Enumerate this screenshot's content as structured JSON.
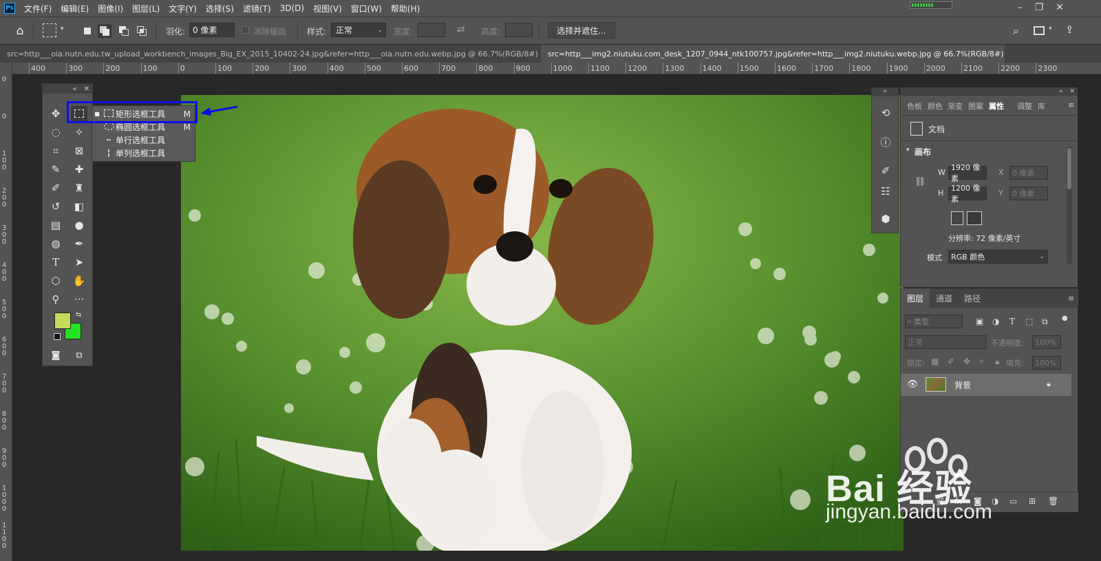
{
  "menu": {
    "logo": "Ps",
    "items": [
      "文件(F)",
      "编辑(E)",
      "图像(I)",
      "图层(L)",
      "文字(Y)",
      "选择(S)",
      "滤镜(T)",
      "3D(D)",
      "视图(V)",
      "窗口(W)",
      "帮助(H)"
    ],
    "progress": 0.55
  },
  "options": {
    "feather_label": "羽化:",
    "feather_value": "0 像素",
    "antialias_label": "消除锯齿",
    "style_label": "样式:",
    "style_value": "正常",
    "width_label": "宽度:",
    "height_label": "高度:",
    "select_mask_label": "选择并遮住..."
  },
  "tabs": [
    {
      "label": "src=http___oia.nutn.edu.tw_upload_workbench_images_Big_EX_2015_10402-24.jpg&refer=http___oia.nutn.edu.webp.jpg @ 66.7%(RGB/8#)",
      "close": "×"
    },
    {
      "label": "src=http___img2.niutuku.com_desk_1207_0944_ntk100757.jpg&refer=http___img2.niutuku.webp.jpg @ 66.7%(RGB/8#)",
      "close": "×"
    }
  ],
  "ruler": {
    "top": [
      "400",
      "300",
      "200",
      "100",
      "0",
      "100",
      "200",
      "300",
      "400",
      "500",
      "600",
      "700",
      "800",
      "900",
      "1000",
      "1100",
      "1200",
      "1300",
      "1400",
      "1500",
      "1600",
      "1700",
      "1800",
      "1900",
      "2000",
      "2100",
      "2200",
      "2300"
    ],
    "left": [
      "0",
      "0",
      "1 0 0",
      "2 0 0",
      "3 0 0",
      "4 0 0",
      "5 0 0",
      "6 0 0",
      "7 0 0",
      "8 0 0",
      "9 0 0",
      "1 0 0 0",
      "1 1 0 0"
    ]
  },
  "flyout": {
    "items": [
      {
        "label": "矩形选框工具",
        "key": "M",
        "icon": "rect-marquee-icon",
        "active": true
      },
      {
        "label": "椭圆选框工具",
        "key": "M",
        "icon": "ellipse-marquee-icon"
      },
      {
        "label": "单行选框工具",
        "key": "",
        "icon": "single-row-marquee-icon"
      },
      {
        "label": "单列选框工具",
        "key": "",
        "icon": "single-column-marquee-icon"
      }
    ]
  },
  "properties": {
    "tabs": [
      "色板",
      "颜色",
      "渐变",
      "图案",
      "属性",
      "调整",
      "库"
    ],
    "active_tab": "属性",
    "doc_label": "文档",
    "canvas_label": "画布",
    "w_label": "W",
    "w_value": "1920 像素",
    "h_label": "H",
    "h_value": "1200 像素",
    "x_label": "X",
    "x_value": "0 像素",
    "y_label": "Y",
    "y_value": "0 像素",
    "resolution": "分辨率: 72 像素/英寸",
    "mode_label": "模式",
    "mode_value": "RGB 颜色"
  },
  "layers": {
    "tabs": [
      "图层",
      "通道",
      "路径"
    ],
    "filter_placeholder": "类型",
    "blend_mode": "正常",
    "opacity_label": "不透明度:",
    "opacity_value": "100%",
    "lock_label": "锁定:",
    "fill_label": "填充:",
    "fill_value": "100%",
    "layer_name": "背景"
  },
  "watermark": {
    "brand": "Bai  经验",
    "url": "jingyan.baidu.com"
  },
  "colors": {
    "foreground": "#c5da5a",
    "background": "#22e422",
    "highlight": "#0b10e6"
  }
}
